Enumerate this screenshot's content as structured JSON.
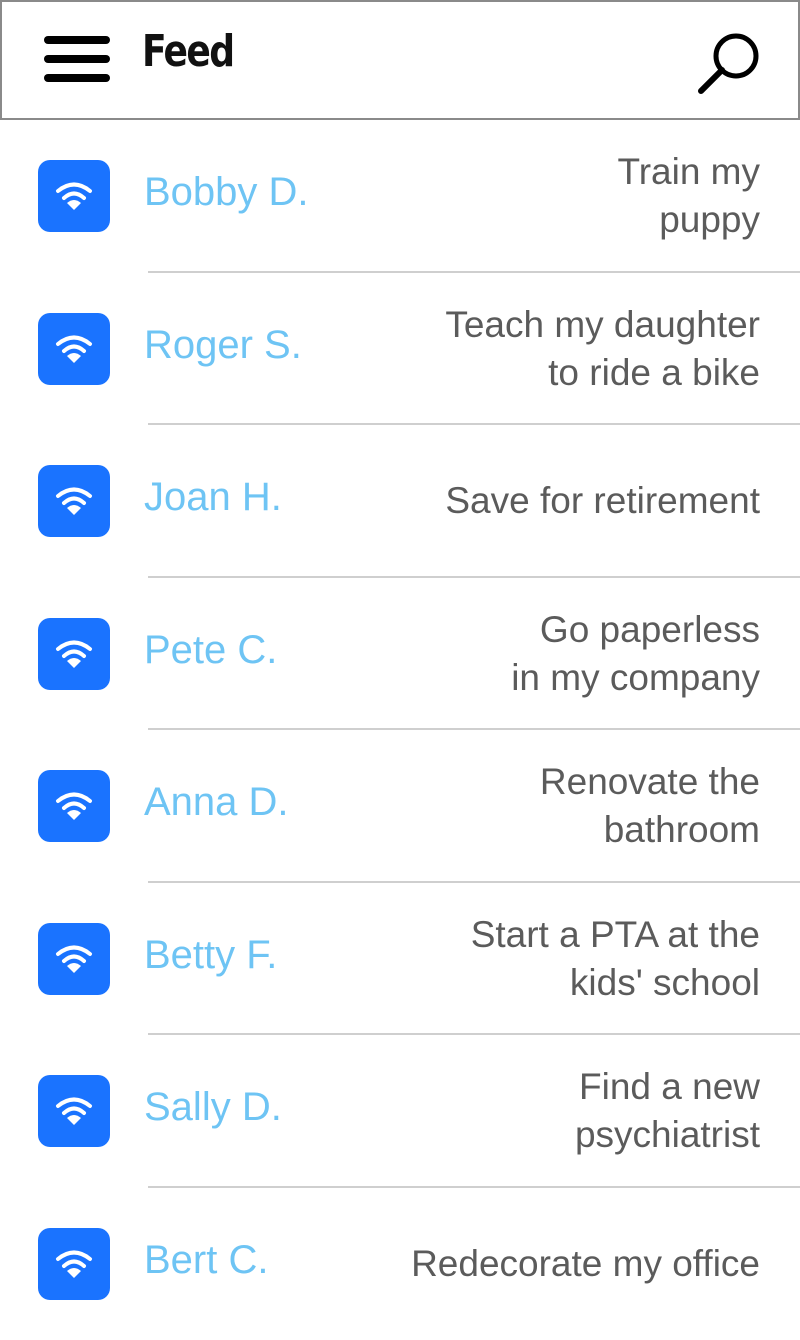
{
  "header": {
    "title": "Feed",
    "menu_icon": "hamburger-menu-icon",
    "search_icon": "search-icon"
  },
  "colors": {
    "accent_blue": "#1a73ff",
    "name_blue": "#6ec4f4",
    "goal_text": "#5b5b5b",
    "divider": "#cfcfcf"
  },
  "feed": {
    "items": [
      {
        "name": "Bobby D.",
        "goal": "Train my\npuppy",
        "icon": "wifi-icon"
      },
      {
        "name": "Roger S.",
        "goal": "Teach my daughter\nto ride a bike",
        "icon": "wifi-icon"
      },
      {
        "name": "Joan H.",
        "goal": "Save for retirement",
        "icon": "wifi-icon"
      },
      {
        "name": "Pete C.",
        "goal": "Go paperless\nin my company",
        "icon": "wifi-icon"
      },
      {
        "name": "Anna D.",
        "goal": "Renovate the\nbathroom",
        "icon": "wifi-icon"
      },
      {
        "name": "Betty F.",
        "goal": "Start a PTA at the\nkids' school",
        "icon": "wifi-icon"
      },
      {
        "name": "Sally D.",
        "goal": "Find a new\npsychiatrist",
        "icon": "wifi-icon"
      },
      {
        "name": "Bert C.",
        "goal": "Redecorate my office",
        "icon": "wifi-icon"
      }
    ]
  }
}
